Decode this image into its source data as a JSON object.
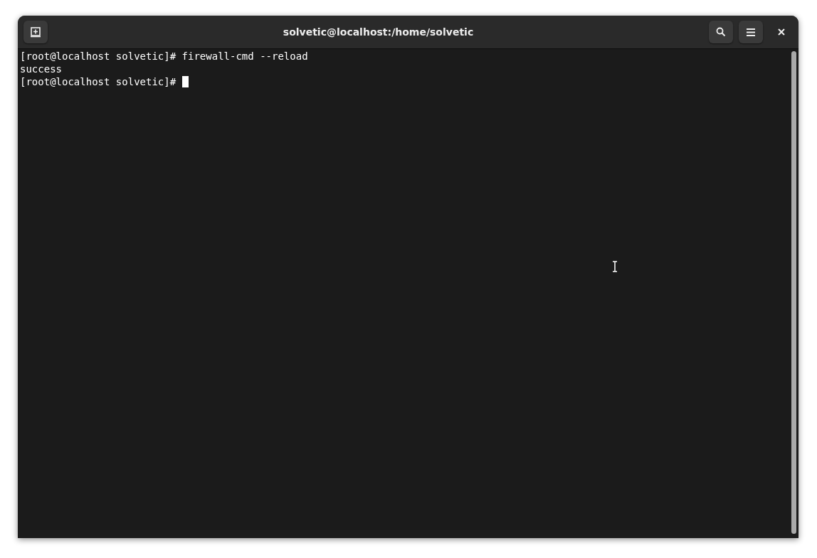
{
  "window": {
    "title": "solvetic@localhost:/home/solvetic"
  },
  "terminal": {
    "lines": [
      {
        "text": "[root@localhost solvetic]# firewall-cmd --reload",
        "cursor": false
      },
      {
        "text": "success",
        "cursor": false
      },
      {
        "text": "[root@localhost solvetic]# ",
        "cursor": true
      }
    ]
  }
}
